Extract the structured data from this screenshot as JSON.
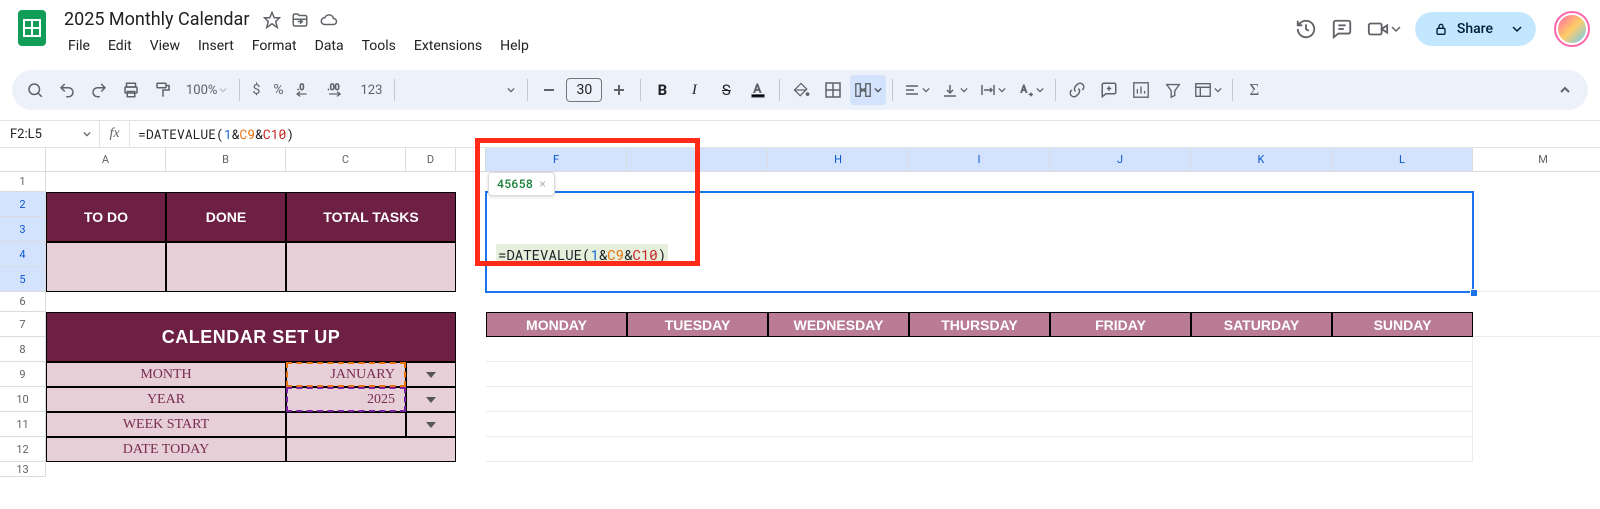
{
  "doc": {
    "title": "2025 Monthly Calendar"
  },
  "menu": {
    "file": "File",
    "edit": "Edit",
    "view": "View",
    "insert": "Insert",
    "format": "Format",
    "data": "Data",
    "tools": "Tools",
    "extensions": "Extensions",
    "help": "Help"
  },
  "share": {
    "label": "Share"
  },
  "toolbar": {
    "zoom": "100%",
    "fontsize": "30",
    "currency": "$",
    "percent": "%",
    "dec_dec": ".0",
    "inc_dec": ".00",
    "fmt": "123"
  },
  "namebox": {
    "value": "F2:L5"
  },
  "formula": {
    "eq": "=",
    "fn": "DATEVALUE",
    "open": "(",
    "arg_num": "1",
    "amp1": "&",
    "ref1": "C9",
    "amp2": "&",
    "ref2": "C10",
    "close": ")"
  },
  "tooltip": {
    "value": "45658",
    "close": "×"
  },
  "cols": {
    "A": "A",
    "B": "B",
    "C": "C",
    "D": "D",
    "F": "F",
    "H": "H",
    "I": "I",
    "J": "J",
    "K": "K",
    "L": "L",
    "M": "M"
  },
  "rows": {
    "r1": "1",
    "r2": "2",
    "r3": "3",
    "r4": "4",
    "r5": "5",
    "r6": "6",
    "r7": "7",
    "r8": "8",
    "r9": "9",
    "r10": "10",
    "r11": "11",
    "r12": "12",
    "r13": "13"
  },
  "todo": {
    "col1": "TO DO",
    "col2": "DONE",
    "col3": "TOTAL TASKS"
  },
  "setup": {
    "title": "CALENDAR SET UP",
    "month_label": "MONTH",
    "month_value": "JANUARY",
    "year_label": "YEAR",
    "year_value": "2025",
    "weekstart_label": "WEEK START",
    "weekstart_value": "",
    "datetoday_label": "DATE TODAY",
    "datetoday_value": ""
  },
  "days": {
    "mon": "MONDAY",
    "tue": "TUESDAY",
    "wed": "WEDNESDAY",
    "thu": "THURSDAY",
    "fri": "FRIDAY",
    "sat": "SATURDAY",
    "sun": "SUNDAY"
  }
}
